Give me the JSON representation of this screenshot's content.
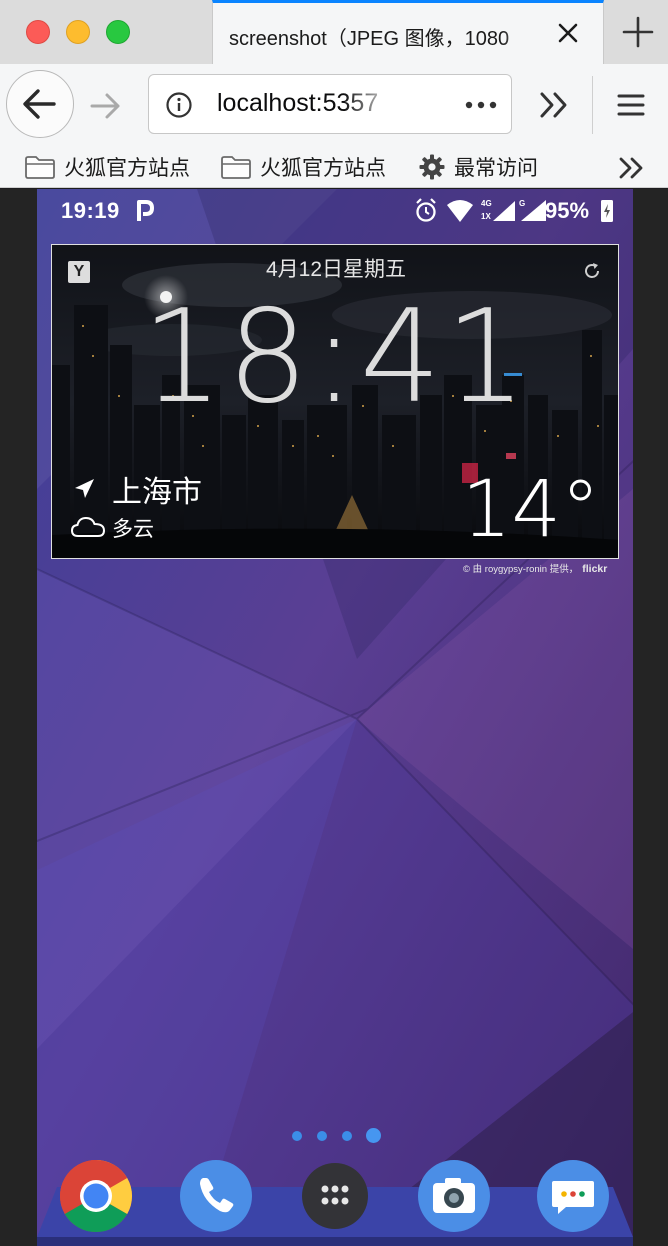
{
  "browser": {
    "tab_title": "screenshot（JPEG 图像，1080",
    "url": "localhost:5357",
    "bookmarks": [
      {
        "label": "火狐官方站点"
      },
      {
        "label": "火狐官方站点"
      },
      {
        "label": "最常访问"
      }
    ]
  },
  "statusbar": {
    "time": "19:19",
    "network_label": "4G",
    "roaming_label": "1X",
    "g_label": "G",
    "battery": "95%"
  },
  "widget": {
    "logo": "Y",
    "date": "4月12日星期五",
    "time": "18:41",
    "city": "上海市",
    "condition": "多云",
    "temperature": "14°"
  },
  "credit": {
    "text": "© 由 roygypsy-ronin 提供，",
    "brand": "flickr"
  },
  "home": {
    "page_count": 4,
    "active_page": 4,
    "dock": [
      "chrome-icon",
      "phone-icon",
      "app-drawer-icon",
      "camera-icon",
      "messages-icon"
    ]
  },
  "colors": {
    "accent": "#0a84ff",
    "wallpaper": "#4b3d8c",
    "page_dot": "#3b8ee8",
    "dock_tray": "#3b44a8"
  }
}
